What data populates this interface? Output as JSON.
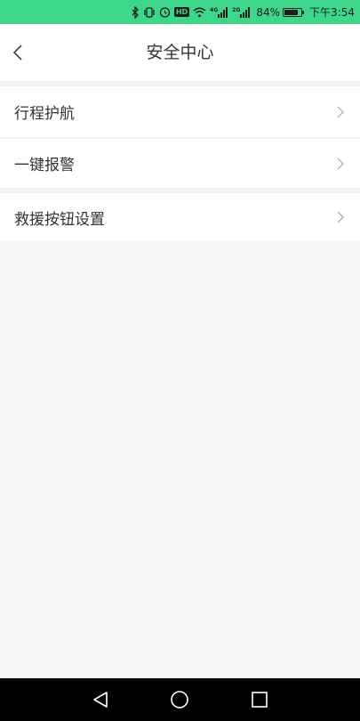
{
  "status_bar": {
    "battery_percent": "84%",
    "time": "下午3:54",
    "network_4g": "4G",
    "network_2g": "2G",
    "hd_badge": "HD",
    "battery_level": 0.84,
    "background_color": "#3ed68a"
  },
  "header": {
    "title": "安全中心"
  },
  "menu": {
    "items": [
      {
        "label": "行程护航"
      },
      {
        "label": "一键报警"
      },
      {
        "label": "救援按钮设置"
      }
    ]
  },
  "navigation_bar": {
    "back": "back-triangle-icon",
    "home": "home-circle-icon",
    "recents": "recents-square-icon"
  }
}
